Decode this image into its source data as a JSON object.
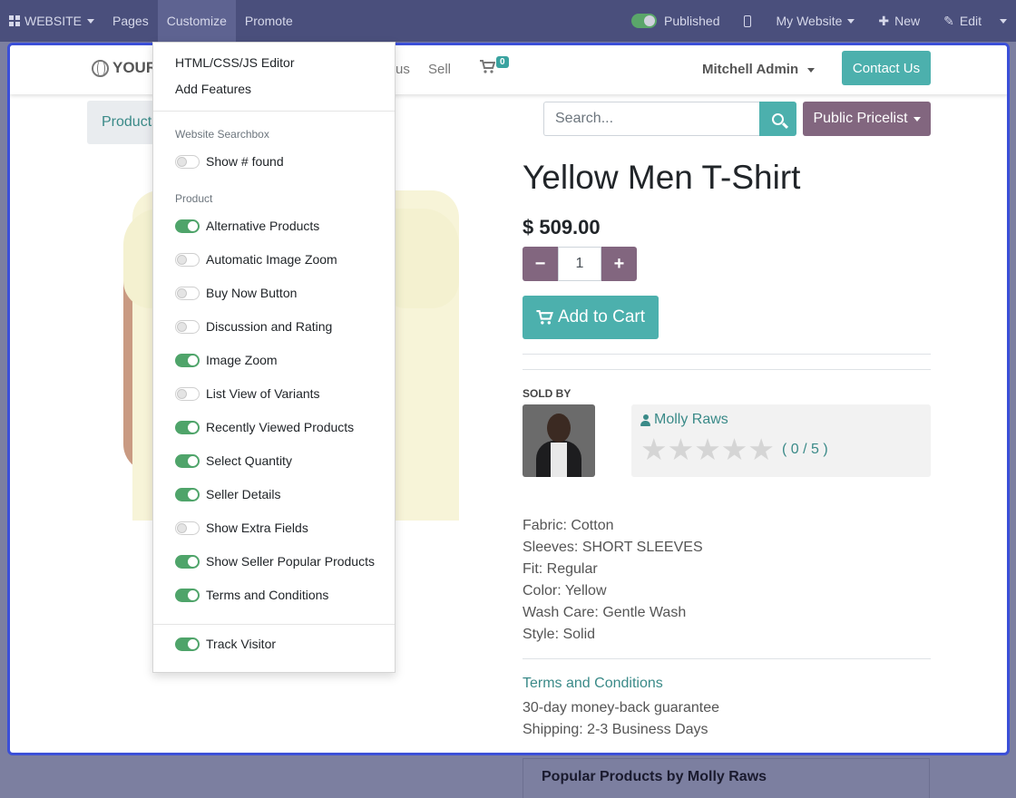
{
  "topbar": {
    "app_label": "WEBSITE",
    "menu": [
      "Pages",
      "Customize",
      "Promote"
    ],
    "published_label": "Published",
    "website_selector": "My Website",
    "new_label": "New",
    "edit_label": "Edit"
  },
  "site": {
    "logo_text": "YOUR",
    "nav_us": "us",
    "nav_sell": "Sell",
    "cart_count": "0",
    "user_name": "Mitchell Admin",
    "contact_label": "Contact Us",
    "breadcrumb": "Products",
    "search_placeholder": "Search...",
    "pricelist_label": "Public Pricelist"
  },
  "product": {
    "title": "Yellow Men T-Shirt",
    "price": "$ 509.00",
    "quantity": "1",
    "add_to_cart": "Add to Cart",
    "sold_by": "SOLD BY",
    "seller_name": "Molly Raws",
    "rating_text": "( 0 / 5 )",
    "rating_value": 0,
    "attributes": [
      "Fabric: Cotton",
      "Sleeves: SHORT SLEEVES",
      "Fit: Regular",
      "Color: Yellow",
      "Wash Care: Gentle Wash",
      "Style: Solid"
    ],
    "terms_link": "Terms and Conditions",
    "terms_lines": [
      "30-day money-back guarantee",
      "Shipping: 2-3 Business Days"
    ],
    "popular_heading": "Popular Products by Molly Raws"
  },
  "customize_menu": {
    "top_items": [
      "HTML/CSS/JS Editor",
      "Add Features"
    ],
    "section_searchbox": "Website Searchbox",
    "searchbox_toggles": [
      {
        "label": "Show # found",
        "on": false
      }
    ],
    "section_product": "Product",
    "product_toggles": [
      {
        "label": "Alternative Products",
        "on": true
      },
      {
        "label": "Automatic Image Zoom",
        "on": false
      },
      {
        "label": "Buy Now Button",
        "on": false
      },
      {
        "label": "Discussion and Rating",
        "on": false
      },
      {
        "label": "Image Zoom",
        "on": true
      },
      {
        "label": "List View of Variants",
        "on": false
      },
      {
        "label": "Recently Viewed Products",
        "on": true
      },
      {
        "label": "Select Quantity",
        "on": true
      },
      {
        "label": "Seller Details",
        "on": true
      },
      {
        "label": "Show Extra Fields",
        "on": false
      },
      {
        "label": "Show Seller Popular Products",
        "on": true
      },
      {
        "label": "Terms and Conditions",
        "on": true
      }
    ],
    "bottom_toggles": [
      {
        "label": "Track Visitor",
        "on": true
      }
    ]
  },
  "colors": {
    "topbar": "#4a4f7c",
    "accent_teal": "#4cb0ad",
    "pricelist_purple": "#82667f",
    "toggle_on": "#4fa46a",
    "frame_border": "#3b4fd8"
  }
}
